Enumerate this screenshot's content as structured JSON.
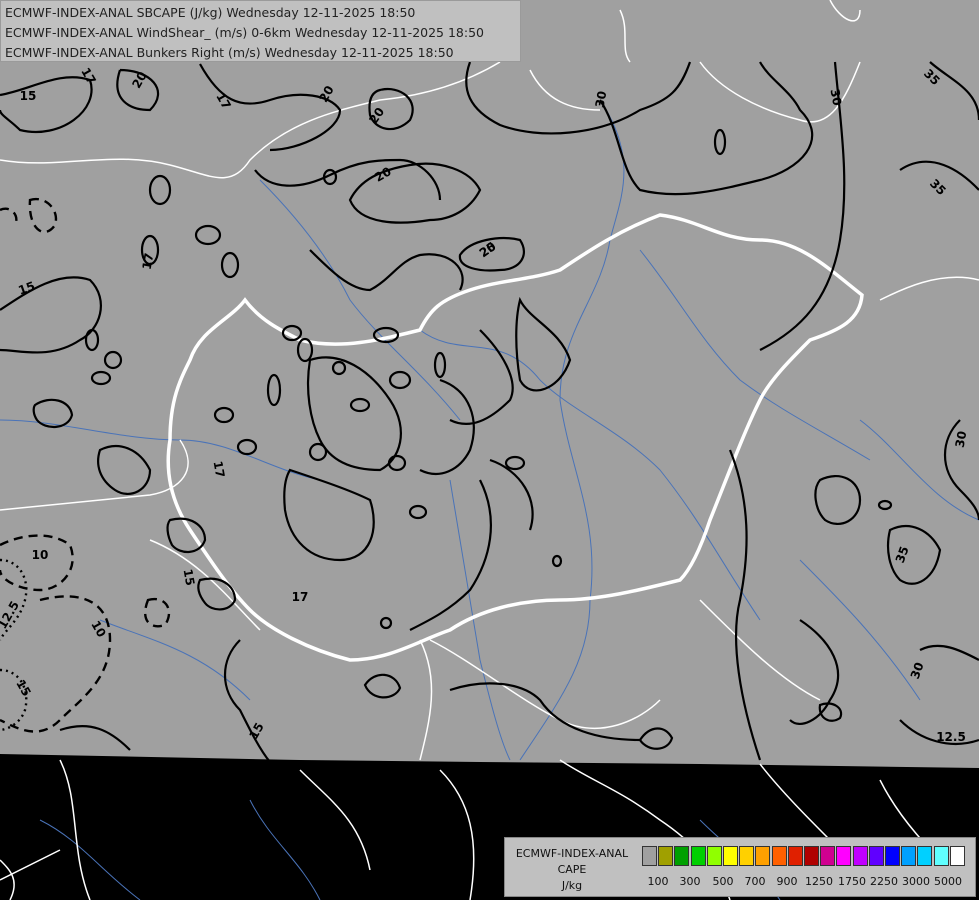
{
  "title_lines": [
    "ECMWF-INDEX-ANAL SBCAPE (J/kg) Wednesday 12-11-2025 18:50",
    "ECMWF-INDEX-ANAL WindShear_ (m/s) 0-6km Wednesday 12-11-2025 18:50",
    "ECMWF-INDEX-ANAL Bunkers Right (m/s) Wednesday 12-11-2025 18:50"
  ],
  "legend": {
    "title_lines": [
      "ECMWF-INDEX-ANAL",
      "CAPE",
      "J/kg"
    ],
    "colors": [
      "#a0a0a0",
      "#a0a000",
      "#00a000",
      "#00d000",
      "#90ff00",
      "#ffff00",
      "#ffd000",
      "#ffa000",
      "#ff6000",
      "#e02000",
      "#b00000",
      "#d00090",
      "#ff00ff",
      "#c000ff",
      "#6000ff",
      "#0000ff",
      "#00a0ff",
      "#00d0ff",
      "#60ffff",
      "#ffffff"
    ],
    "labels": [
      "100",
      "300",
      "500",
      "700",
      "900",
      "1250",
      "1750",
      "2250",
      "3000",
      "5000"
    ]
  },
  "contour_labels": [
    "15",
    "17",
    "20",
    "17",
    "20",
    "20",
    "20",
    "25",
    "30",
    "30",
    "35",
    "17",
    "15",
    "17",
    "15",
    "17",
    "20",
    "30",
    "35",
    "35",
    "30",
    "12.5",
    "10",
    "12.5",
    "10",
    "15",
    "15"
  ],
  "colors": {
    "field": "#a0a0a0",
    "background": "#000000",
    "borders": "#ffffff",
    "rivers": "#4a73b8",
    "contours": "#000000"
  }
}
